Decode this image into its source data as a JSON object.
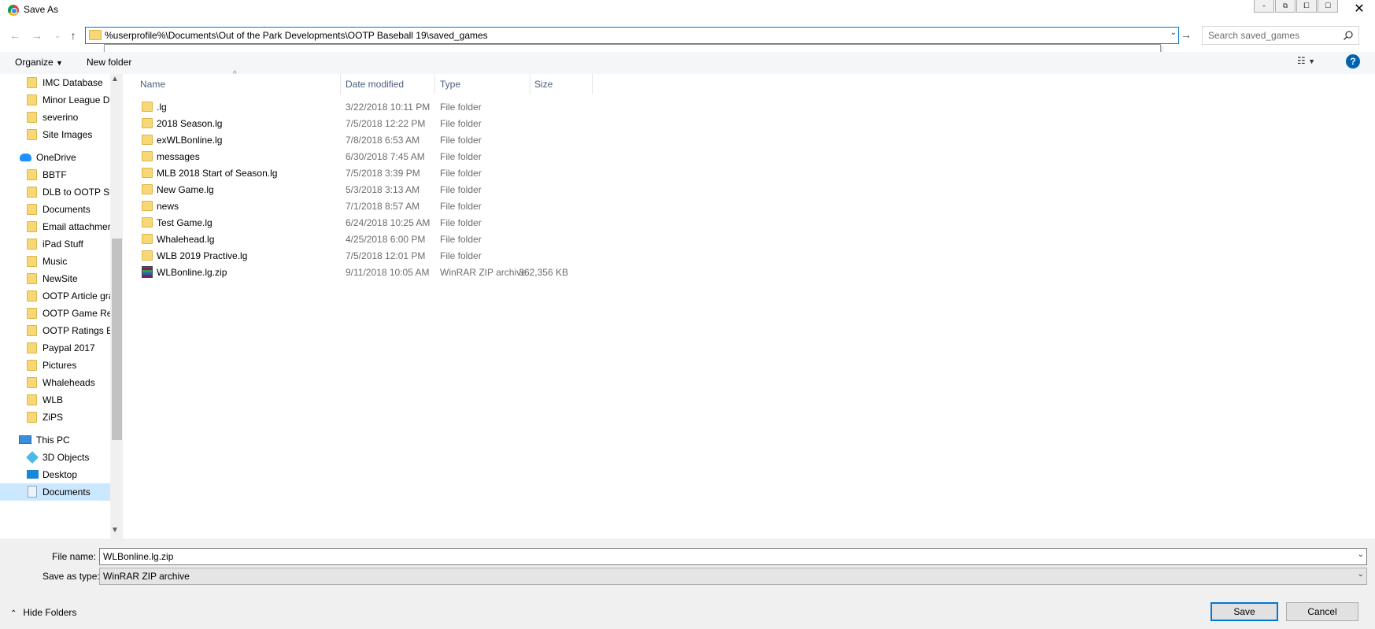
{
  "window": {
    "title": "Save As"
  },
  "address": {
    "path": "%userprofile%\\Documents\\Out of the Park Developments\\OOTP Baseball 19\\saved_games",
    "search_placeholder": "Search saved_games"
  },
  "toolbar": {
    "organize_label": "Organize",
    "new_folder_label": "New folder"
  },
  "nav": {
    "items": [
      {
        "label": "IMC Database"
      },
      {
        "label": "Minor League Du"
      },
      {
        "label": "severino"
      },
      {
        "label": "Site Images"
      },
      {
        "label": "OneDrive"
      },
      {
        "label": "BBTF"
      },
      {
        "label": "DLB to OOTP Sta"
      },
      {
        "label": "Documents"
      },
      {
        "label": "Email attachmen"
      },
      {
        "label": "iPad Stuff"
      },
      {
        "label": "Music"
      },
      {
        "label": "NewSite"
      },
      {
        "label": "OOTP Article gra"
      },
      {
        "label": "OOTP Game Res"
      },
      {
        "label": "OOTP Ratings Ex"
      },
      {
        "label": "Paypal 2017"
      },
      {
        "label": "Pictures"
      },
      {
        "label": "Whaleheads"
      },
      {
        "label": "WLB"
      },
      {
        "label": "ZiPS"
      },
      {
        "label": "This PC"
      },
      {
        "label": "3D Objects"
      },
      {
        "label": "Desktop"
      },
      {
        "label": "Documents"
      }
    ]
  },
  "columns": {
    "name": "Name",
    "date": "Date modified",
    "type": "Type",
    "size": "Size"
  },
  "files": [
    {
      "name": ".lg",
      "date": "3/22/2018 10:11 PM",
      "type": "File folder",
      "size": ""
    },
    {
      "name": "2018 Season.lg",
      "date": "7/5/2018 12:22 PM",
      "type": "File folder",
      "size": ""
    },
    {
      "name": "exWLBonline.lg",
      "date": "7/8/2018 6:53 AM",
      "type": "File folder",
      "size": ""
    },
    {
      "name": "messages",
      "date": "6/30/2018 7:45 AM",
      "type": "File folder",
      "size": ""
    },
    {
      "name": "MLB 2018 Start of Season.lg",
      "date": "7/5/2018 3:39 PM",
      "type": "File folder",
      "size": ""
    },
    {
      "name": "New Game.lg",
      "date": "5/3/2018 3:13 AM",
      "type": "File folder",
      "size": ""
    },
    {
      "name": "news",
      "date": "7/1/2018 8:57 AM",
      "type": "File folder",
      "size": ""
    },
    {
      "name": "Test Game.lg",
      "date": "6/24/2018 10:25 AM",
      "type": "File folder",
      "size": ""
    },
    {
      "name": "Whalehead.lg",
      "date": "4/25/2018 6:00 PM",
      "type": "File folder",
      "size": ""
    },
    {
      "name": "WLB 2019 Practive.lg",
      "date": "7/5/2018 12:01 PM",
      "type": "File folder",
      "size": ""
    },
    {
      "name": "WLBonline.lg.zip",
      "date": "9/11/2018 10:05 AM",
      "type": "WinRAR ZIP archive",
      "size": "362,356 KB"
    }
  ],
  "form": {
    "file_name_label": "File name:",
    "file_name_value": "WLBonline.lg.zip",
    "save_type_label": "Save as type:",
    "save_type_value": "WinRAR ZIP archive"
  },
  "footer": {
    "hide_folders_label": "Hide Folders",
    "save_label": "Save",
    "cancel_label": "Cancel"
  },
  "colors": {
    "accent": "#0078d7",
    "selection": "#cce8ff",
    "folder": "#f8d775"
  }
}
